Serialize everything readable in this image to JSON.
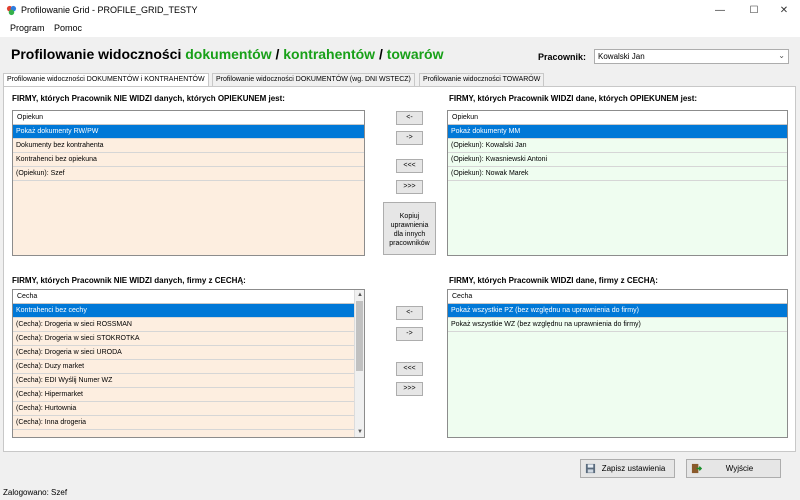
{
  "window": {
    "title": "Profilowanie Grid - PROFILE_GRID_TESTY",
    "minimize": "—",
    "maximize": "☐",
    "close": "✕"
  },
  "menu": {
    "program": "Program",
    "help": "Pomoc"
  },
  "header": {
    "title_prefix": "Profilowanie widoczności",
    "title_documents": "dokumentów",
    "title_sep1": "/",
    "title_contractors": "kontrahentów",
    "title_sep2": "/",
    "title_goods": "towarów",
    "employee_label": "Pracownik:",
    "employee_value": "Kowalski Jan"
  },
  "tabs": [
    {
      "label": "Profilowanie widoczności DOKUMENTÓW i KONTRAHENTÓW",
      "active": true
    },
    {
      "label": "Profilowanie widoczności DOKUMENTÓW (wg. DNI WSTECZ)",
      "active": false
    },
    {
      "label": "Profilowanie widoczności TOWARÓW",
      "active": false
    }
  ],
  "top_left": {
    "label": "FIRMY, których Pracownik NIE WIDZI danych, których OPIEKUNEM jest:",
    "column": "Opiekun",
    "rows": [
      "Pokaż dokumenty RW/PW",
      "Dokumenty bez kontrahenta",
      "Kontrahenci bez opiekuna",
      "(Opiekun): Szef"
    ]
  },
  "top_right": {
    "label": "FIRMY, których Pracownik WIDZI dane, których OPIEKUNEM jest:",
    "column": "Opiekun",
    "rows": [
      "Pokaż dokumenty MM",
      "(Opiekun): Kowalski Jan",
      "(Opiekun): Kwasniewski Antoni",
      "(Opiekun): Nowak Marek"
    ]
  },
  "bottom_left": {
    "label": "FIRMY, których Pracownik NIE WIDZI danych, firmy z CECHĄ:",
    "column": "Cecha",
    "rows": [
      "Kontrahenci bez cechy",
      "(Cecha): Drogeria w sieci ROSSMAN",
      "(Cecha): Drogeria w sieci STOKROTKA",
      "(Cecha): Drogeria w sieci URODA",
      "(Cecha): Duzy market",
      "(Cecha): EDI Wyślij Numer WZ",
      "(Cecha): Hipermarket",
      "(Cecha): Hurtownia",
      "(Cecha): Inna drogeria"
    ]
  },
  "bottom_right": {
    "label": "FIRMY, których Pracownik WIDZI dane, firmy z CECHĄ:",
    "column": "Cecha",
    "rows": [
      "Pokaż wszystkie PZ (bez względnu na uprawnienia do firmy)",
      "Pokaż wszystkie WZ (bez względnu na uprawnienia do firmy)"
    ]
  },
  "move_buttons": {
    "left_one": "<-",
    "right_one": "->",
    "left_all": "<<<",
    "right_all": ">>>"
  },
  "copy_button": [
    "Kopiuj",
    "uprawnienia",
    "dla innych",
    "pracowników"
  ],
  "footer": {
    "save": "Zapisz ustawienia",
    "exit": "Wyjście"
  },
  "status": "Zalogowano: Szef",
  "colors": {
    "selection": "#0078d7",
    "accent_green": "#18a018",
    "grid_pink": "#fdeee0",
    "grid_mint": "#effdf0"
  }
}
